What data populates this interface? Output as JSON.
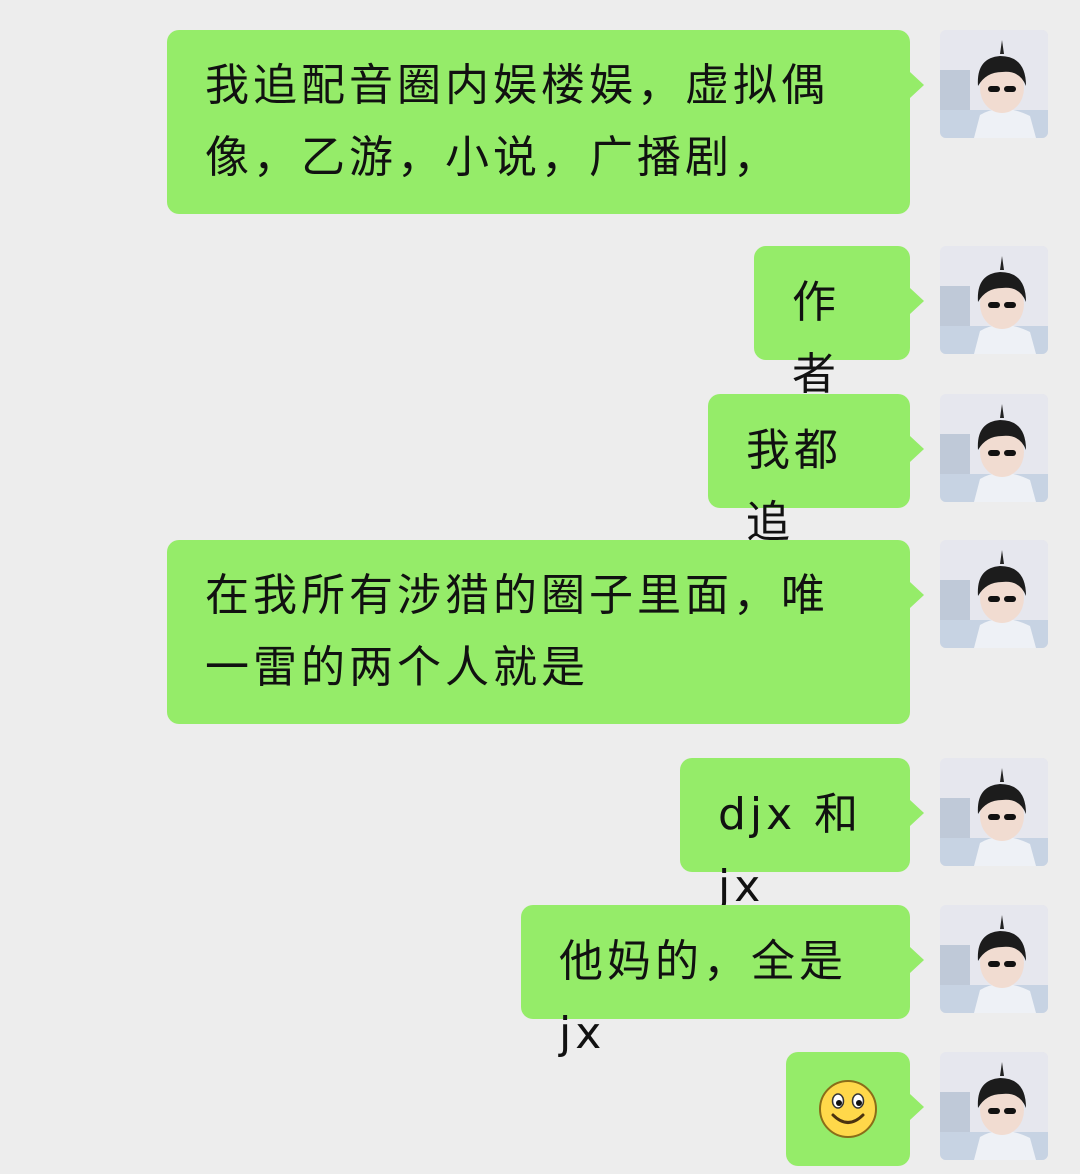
{
  "messages": [
    {
      "text": "我追配音圈内娱楼娱，虚拟偶像，乙游，小说，广播剧，",
      "sender": "self"
    },
    {
      "text": "作者",
      "sender": "self"
    },
    {
      "text": "我都追",
      "sender": "self"
    },
    {
      "text": "在我所有涉猎的圈子里面，唯一雷的两个人就是",
      "sender": "self"
    },
    {
      "text": "djx 和 jx",
      "sender": "self"
    },
    {
      "text": "他妈的，全是 jx",
      "sender": "self"
    },
    {
      "sticker": "smiley-emoji",
      "sender": "self"
    }
  ],
  "colors": {
    "background": "#ededed",
    "bubble": "#95ec69",
    "text": "#111111",
    "emoji_face": "#ffd84a"
  },
  "icons": {
    "avatar": "user-avatar-photo",
    "emoji": "smiley-face"
  }
}
